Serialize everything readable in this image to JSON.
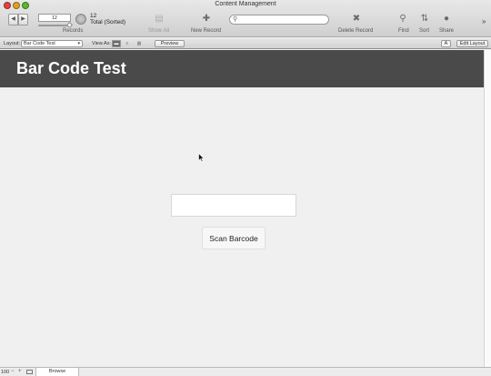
{
  "window": {
    "title": "Content Management"
  },
  "toolbar": {
    "current_record": "12",
    "record_count": "12",
    "found_status": "Total (Sorted)",
    "records_label": "Records",
    "show_all_label": "Show All",
    "new_record_label": "New Record",
    "delete_record_label": "Delete Record",
    "find_label": "Find",
    "sort_label": "Sort",
    "share_label": "Share",
    "search_placeholder": "",
    "overflow_glyph": "»"
  },
  "layout_bar": {
    "layout_label": "Layout:",
    "layout_value": "Bar Code Test",
    "view_as_label": "View As:",
    "preview_label": "Preview",
    "text_format_label": "A",
    "edit_layout_label": "Edit Layout"
  },
  "content": {
    "header_title": "Bar Code Test",
    "barcode_field_value": "",
    "scan_button_label": "Scan Barcode"
  },
  "status_bar": {
    "zoom": "100",
    "mode": "Browse"
  },
  "icons": {
    "prev": "◀",
    "next": "▶",
    "search": "⚲",
    "show_all": "▤",
    "new_record": "✚",
    "delete_record": "✖",
    "find": "⚲",
    "sort": "⇅",
    "share": "●",
    "dropdown": "▾",
    "zoom_out": "−",
    "zoom_in": "+",
    "view_form": "▬",
    "view_list": "≡",
    "view_table": "▦"
  }
}
